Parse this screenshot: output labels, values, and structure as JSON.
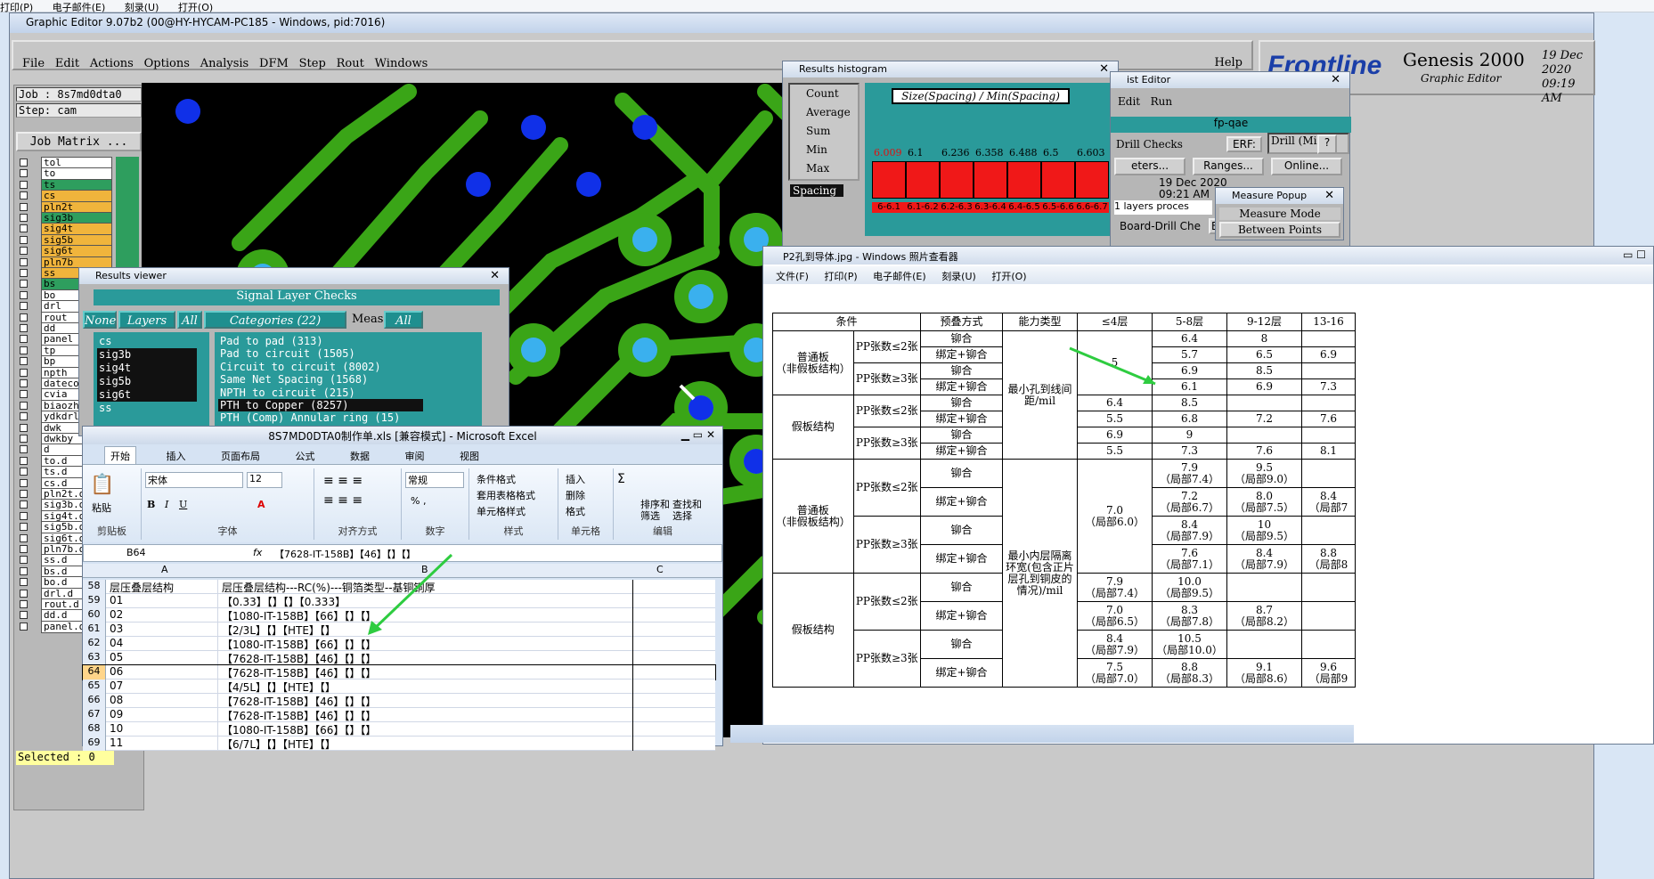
{
  "top_strip": {
    "items": [
      "打印(P)",
      "电子邮件(E)",
      "刻录(U)",
      "打开(O)"
    ]
  },
  "genesis": {
    "title": "Graphic Editor 9.07b2 (00@HY-HYCAM-PC185 - Windows, pid:7016)",
    "menu": [
      "File",
      "Edit",
      "Actions",
      "Options",
      "Analysis",
      "DFM",
      "Step",
      "Rout",
      "Windows"
    ],
    "help": "Help",
    "brand": "Frontline",
    "product": "Genesis 2000",
    "subtitle": "Graphic Editor",
    "date": "19 Dec 2020",
    "time": "09:19 AM",
    "job": "Job : 8s7md0dta0",
    "step": "Step: cam",
    "job_matrix": "Job Matrix ...",
    "selected": "Selected : 0",
    "layers": [
      {
        "name": "tol",
        "color": "#ffffff"
      },
      {
        "name": "to",
        "color": "#ffffff"
      },
      {
        "name": "ts",
        "color": "#2e9e5e"
      },
      {
        "name": "cs",
        "color": "#f0b43c"
      },
      {
        "name": "pln2t",
        "color": "#f0b43c"
      },
      {
        "name": "sig3b",
        "color": "#2e9e5e"
      },
      {
        "name": "sig4t",
        "color": "#f0b43c"
      },
      {
        "name": "sig5b",
        "color": "#f0b43c"
      },
      {
        "name": "sig6t",
        "color": "#f0b43c"
      },
      {
        "name": "pln7b",
        "color": "#f0b43c"
      },
      {
        "name": "ss",
        "color": "#f0b43c"
      },
      {
        "name": "bs",
        "color": "#2e9e5e"
      },
      {
        "name": "bo",
        "color": "#ffffff"
      },
      {
        "name": "drl",
        "color": "#ffffff"
      },
      {
        "name": "rout",
        "color": "#ffffff"
      },
      {
        "name": "dd",
        "color": "#ffffff"
      },
      {
        "name": "panel",
        "color": "#ffffff"
      },
      {
        "name": "tp",
        "color": "#ffffff"
      },
      {
        "name": "bp",
        "color": "#ffffff"
      },
      {
        "name": "npth",
        "color": "#ffffff"
      },
      {
        "name": "datecod",
        "color": "#ffffff"
      },
      {
        "name": "cvia",
        "color": "#ffffff"
      },
      {
        "name": "biaozhu",
        "color": "#ffffff"
      },
      {
        "name": "ydkdrl",
        "color": "#ffffff"
      },
      {
        "name": "dwk",
        "color": "#ffffff"
      },
      {
        "name": "dwkby",
        "color": "#ffffff"
      },
      {
        "name": "d",
        "color": "#ffffff"
      },
      {
        "name": "to.d",
        "color": "#ffffff"
      },
      {
        "name": "ts.d",
        "color": "#ffffff"
      },
      {
        "name": "cs.d",
        "color": "#ffffff"
      },
      {
        "name": "pln2t.d",
        "color": "#ffffff"
      },
      {
        "name": "sig3b.d",
        "color": "#ffffff"
      },
      {
        "name": "sig4t.d",
        "color": "#ffffff"
      },
      {
        "name": "sig5b.d",
        "color": "#ffffff"
      },
      {
        "name": "sig6t.d",
        "color": "#ffffff"
      },
      {
        "name": "pln7b.d",
        "color": "#ffffff"
      },
      {
        "name": "ss.d",
        "color": "#ffffff"
      },
      {
        "name": "bs.d",
        "color": "#ffffff"
      },
      {
        "name": "bo.d",
        "color": "#ffffff"
      },
      {
        "name": "drl.d",
        "color": "#ffffff"
      },
      {
        "name": "rout.d",
        "color": "#ffffff"
      },
      {
        "name": "dd.d",
        "color": "#ffffff"
      },
      {
        "name": "panel.d",
        "color": "#ffffff"
      }
    ]
  },
  "results_viewer": {
    "title": "Results viewer",
    "header": "Signal Layer Checks",
    "none_btn": "None",
    "layers_btn": "Layers",
    "all_btn": "All",
    "categories_btn": "Categories (22)",
    "meas_label": "Meas:",
    "meas_value": "All",
    "layers": [
      "cs",
      "sig3b",
      "sig4t",
      "sig5b",
      "sig6t",
      "ss"
    ],
    "categories": [
      "Pad to pad (313)",
      "Pad to circuit (1505)",
      "Circuit to circuit (8002)",
      "Same Net Spacing (1568)",
      "NPTH to circuit (215)",
      "PTH to Copper (8257)",
      "PTH (Comp) Annular ring (15)"
    ]
  },
  "histogram": {
    "title": "Results histogram",
    "options": [
      "Count",
      "Average",
      "Sum",
      "Min",
      "Max"
    ],
    "selected_option": "Min",
    "chart_title": "Size(Spacing) / Min(Spacing)",
    "measure": "Spacing",
    "bins": [
      "6-6.1",
      "6.1-6.2",
      "6.2-6.3",
      "6.3-6.4",
      "6.4-6.5",
      "6.5-6.6",
      "6.6-6.7"
    ],
    "values": [
      "6.009",
      "6.1",
      "6.236",
      "6.358",
      "6.488",
      "6.5",
      "6.603"
    ]
  },
  "checklist": {
    "title": "ist Editor",
    "edit": "Edit",
    "run": "Run",
    "name": "fp-qae",
    "drill_checks": "Drill Checks",
    "erf": "ERF:",
    "erf_value": "Drill (Mil",
    "params": "eters...",
    "ranges": "Ranges...",
    "online": "Online...",
    "date": "19 Dec 2020",
    "time": "09:21 AM",
    "status": "1 layers proces",
    "board_drill": "Board-Drill Che",
    "er": "ER"
  },
  "measure_popup": {
    "title": "Measure Popup",
    "mode": "Measure Mode",
    "between": "Between Points"
  },
  "excel": {
    "title": "8S7MD0DTA0制作单.xls  [兼容模式] - Microsoft Excel",
    "tabs": [
      "开始",
      "插入",
      "页面布局",
      "公式",
      "数据",
      "审阅",
      "视图"
    ],
    "font_name": "宋体",
    "font_size": "12",
    "number_format": "常规",
    "groups": [
      "剪贴板",
      "字体",
      "对齐方式",
      "数字",
      "样式",
      "单元格",
      "编辑"
    ],
    "paste": "粘贴",
    "styles": [
      "条件格式",
      "套用表格格式",
      "单元格样式"
    ],
    "cells_btns": [
      "插入",
      "删除",
      "格式"
    ],
    "edit_btns": [
      "排序和\n筛选",
      "查找和\n选择"
    ],
    "cell_ref": "B64",
    "formula": "【7628-IT-158B】【46】【】【】",
    "cols": [
      "A",
      "B",
      "C"
    ],
    "rows": [
      {
        "n": "58",
        "a": "层压叠层结构",
        "b": "层压叠层结构---RC(%)---铜箔类型--基铜铜厚"
      },
      {
        "n": "59",
        "a": "01",
        "b": "【0.33】【】【】【0.333】"
      },
      {
        "n": "60",
        "a": "02",
        "b": "【1080-IT-158B】【66】【】【】"
      },
      {
        "n": "61",
        "a": "03",
        "b": "【2/3L】【】【HTE】【】"
      },
      {
        "n": "62",
        "a": "04",
        "b": "【1080-IT-158B】【66】【】【】"
      },
      {
        "n": "63",
        "a": "05",
        "b": "【7628-IT-158B】【46】【】【】"
      },
      {
        "n": "64",
        "a": "06",
        "b": "【7628-IT-158B】【46】【】【】"
      },
      {
        "n": "65",
        "a": "07",
        "b": "【4/5L】【】【HTE】【】"
      },
      {
        "n": "66",
        "a": "08",
        "b": "【7628-IT-158B】【46】【】【】"
      },
      {
        "n": "67",
        "a": "09",
        "b": "【7628-IT-158B】【46】【】【】"
      },
      {
        "n": "68",
        "a": "10",
        "b": "【1080-IT-158B】【66】【】【】"
      },
      {
        "n": "69",
        "a": "11",
        "b": "【6/7L】【】【HTE】【】"
      }
    ]
  },
  "photo_viewer": {
    "title": "P2孔到导体.jpg - Windows 照片查看器",
    "menu": [
      "文件(F)",
      "打印(P)",
      "电子邮件(E)",
      "刻录(U)",
      "打开(O)"
    ],
    "header": [
      "条件",
      "预叠方式",
      "能力类型",
      "≤4层",
      "5-8层",
      "9-12层",
      "13-16"
    ],
    "groups": [
      "普通板\n（非假板结构）",
      "假板结构",
      "普通板\n（非假板结构）",
      "假板结构"
    ],
    "pp_le2": "PP张数≤2张",
    "pp_ge3": "PP张数≥3张",
    "rivet": "铆合",
    "bind_rivet": "绑定+铆合",
    "type1": "最小孔到线间距/mil",
    "type2": "最小内层隔离环宽(包含正片层孔到铜皮的情况)/mil",
    "sec1": [
      [
        "",
        "6.4",
        "8",
        ""
      ],
      [
        "",
        "5.7",
        "6.5",
        "6.9"
      ],
      [
        "",
        "6.9",
        "8.5",
        ""
      ],
      [
        "",
        "6.1",
        "6.9",
        "7.3"
      ],
      [
        "6.4",
        "8.5",
        "",
        ""
      ],
      [
        "5.5",
        "6.8",
        "7.2",
        "7.6"
      ],
      [
        "6.9",
        "9",
        "",
        ""
      ],
      [
        "5.5",
        "7.3",
        "7.6",
        "8.1"
      ]
    ],
    "sec1_le4": "5",
    "sec2": [
      [
        "",
        "7.9\n（局部7.4）",
        "9.5\n（局部9.0）",
        ""
      ],
      [
        "",
        "7.2\n（局部6.7）",
        "8.0\n（局部7.5）",
        "8.4\n（局部7"
      ],
      [
        "",
        "8.4\n（局部7.9）",
        "10\n（局部9.5）",
        ""
      ],
      [
        "",
        "7.6\n（局部7.1）",
        "8.4\n（局部7.9）",
        "8.8\n（局部8"
      ],
      [
        "7.9\n（局部7.4）",
        "10.0\n（局部9.5）",
        "",
        ""
      ],
      [
        "7.0\n（局部6.5）",
        "8.3\n（局部7.8）",
        "8.7\n（局部8.2）",
        ""
      ],
      [
        "8.4\n（局部7.9）",
        "10.5\n（局部10.0）",
        "",
        ""
      ],
      [
        "7.5\n（局部7.0）",
        "8.8\n（局部8.3）",
        "9.1\n（局部8.6）",
        "9.6\n（局部9"
      ]
    ],
    "sec2_le4": "7.0\n（局部6.0）"
  }
}
